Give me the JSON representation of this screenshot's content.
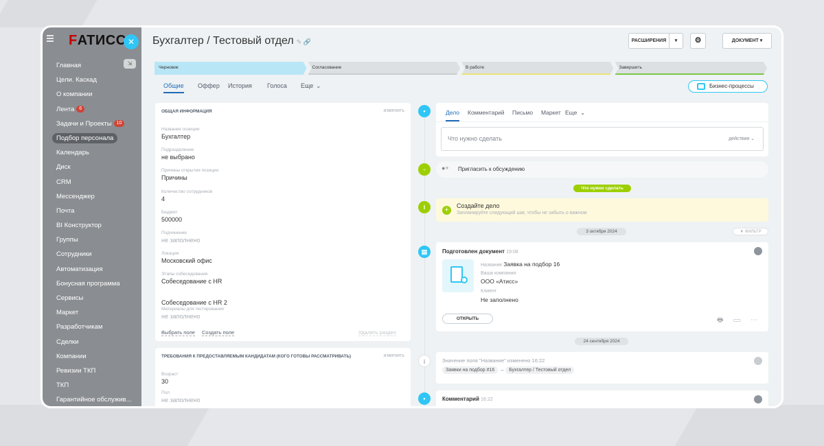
{
  "sidebar": {
    "logo": "ATИСС",
    "logo_mark": "F",
    "items": [
      {
        "label": "Главная"
      },
      {
        "label": "Цели. Каскад"
      },
      {
        "label": "О компании"
      },
      {
        "label": "Лента",
        "badge": "6"
      },
      {
        "label": "Задачи и Проекты",
        "badge": "10"
      },
      {
        "label": "Подбор персонала",
        "active": true
      },
      {
        "label": "Календарь"
      },
      {
        "label": "Диск"
      },
      {
        "label": "CRM"
      },
      {
        "label": "Мессенджер"
      },
      {
        "label": "Почта"
      },
      {
        "label": "BI Конструктор"
      },
      {
        "label": "Группы"
      },
      {
        "label": "Сотрудники"
      },
      {
        "label": "Автоматизация"
      },
      {
        "label": "Бонусная программа"
      },
      {
        "label": "Сервисы"
      },
      {
        "label": "Маркет"
      },
      {
        "label": "Разработчикам"
      },
      {
        "label": "Сделки"
      },
      {
        "label": "Компании"
      },
      {
        "label": "Ревизии ТКП"
      },
      {
        "label": "ТКП"
      },
      {
        "label": "Гарантийное обслужив..."
      }
    ]
  },
  "header": {
    "title": "Бухгалтер / Тестовый отдел",
    "extensions": "РАСШИРЕНИЯ",
    "document": "ДОКУМЕНТ"
  },
  "stages": [
    {
      "label": "Черновик",
      "color": "#b8e6f7",
      "line": "#b8e6f7"
    },
    {
      "label": "Согласование",
      "color": "#dde0e3",
      "line": "#c9cdd1"
    },
    {
      "label": "В работе",
      "color": "#dde0e3",
      "line": "#e9e27a"
    },
    {
      "label": "Завершить",
      "color": "#dde0e3",
      "line": "#7ac943"
    }
  ],
  "tabs": [
    "Общие",
    "Оффер",
    "История",
    "Голоса",
    "Еще"
  ],
  "bp_button": "Бизнес-процессы",
  "general": {
    "title": "ОБЩАЯ ИНФОРМАЦИЯ",
    "edit": "изменить",
    "fields": [
      {
        "label": "Название позиции",
        "value": "Бухгалтер"
      },
      {
        "label": "Подразделение",
        "value": "не выбрано"
      },
      {
        "label": "Причины открытия позиции",
        "value": "Причины"
      },
      {
        "label": "Количество сотрудников",
        "value": "4"
      },
      {
        "label": "Бюджет",
        "value": "500000"
      },
      {
        "label": "Подчинение",
        "value": "не заполнено",
        "empty": true
      },
      {
        "label": "Локация",
        "value": "Московский офис"
      },
      {
        "label": "Этапы собеседования",
        "value": "Собеседование с HR"
      },
      {
        "label": "",
        "value": "Собеседование с HR 2"
      },
      {
        "label": "Материалы для тестирования",
        "value": "не заполнено",
        "empty": true
      }
    ],
    "select_field": "Выбрать поле",
    "create_field": "Создать поле",
    "delete_section": "Удалить раздел"
  },
  "requirements": {
    "title": "ТРЕБОВАНИЯ К ПРЕДОСТАВЛЯЕМЫМ КАНДИДАТАМ (КОГО ГОТОВЫ РАССМАТРИВАТЬ)",
    "edit": "изменить",
    "fields": [
      {
        "label": "Возраст",
        "value": "30"
      },
      {
        "label": "Пол",
        "value": "не заполнено",
        "empty": true
      }
    ]
  },
  "activity": {
    "tabs": [
      "Дело",
      "Комментарий",
      "Письмо",
      "Маркет",
      "Еще"
    ],
    "input_placeholder": "Что нужно сделать",
    "actions": "действия",
    "invite": "Пригласить к обсуждению",
    "todo_pill": "Что нужно сделать",
    "create_title": "Создайте дело",
    "create_sub": "Запланируйте следующий шаг, чтобы не забыть о важном",
    "date1": "3 октября 2024",
    "filter": "ФИЛЬТР",
    "doc": {
      "title": "Подготовлен документ",
      "time": "19:08",
      "name_label": "Название",
      "name_value": "Заявка на подбор 16",
      "company_label": "Ваша компания",
      "company_value": "ООО «Атисс»",
      "client_label": "Клиент",
      "client_value": "Не заполнено",
      "open": "ОТКРЫТЬ"
    },
    "date2": "24 сентября 2024",
    "change": {
      "title": "Значение поля \"Название\" изменено",
      "time": "16:22",
      "from": "Заявки на подбор #16",
      "to": "Бухгалтер / Тестовый отдел"
    },
    "comment": {
      "title": "Комментарий",
      "time": "16:22"
    }
  }
}
